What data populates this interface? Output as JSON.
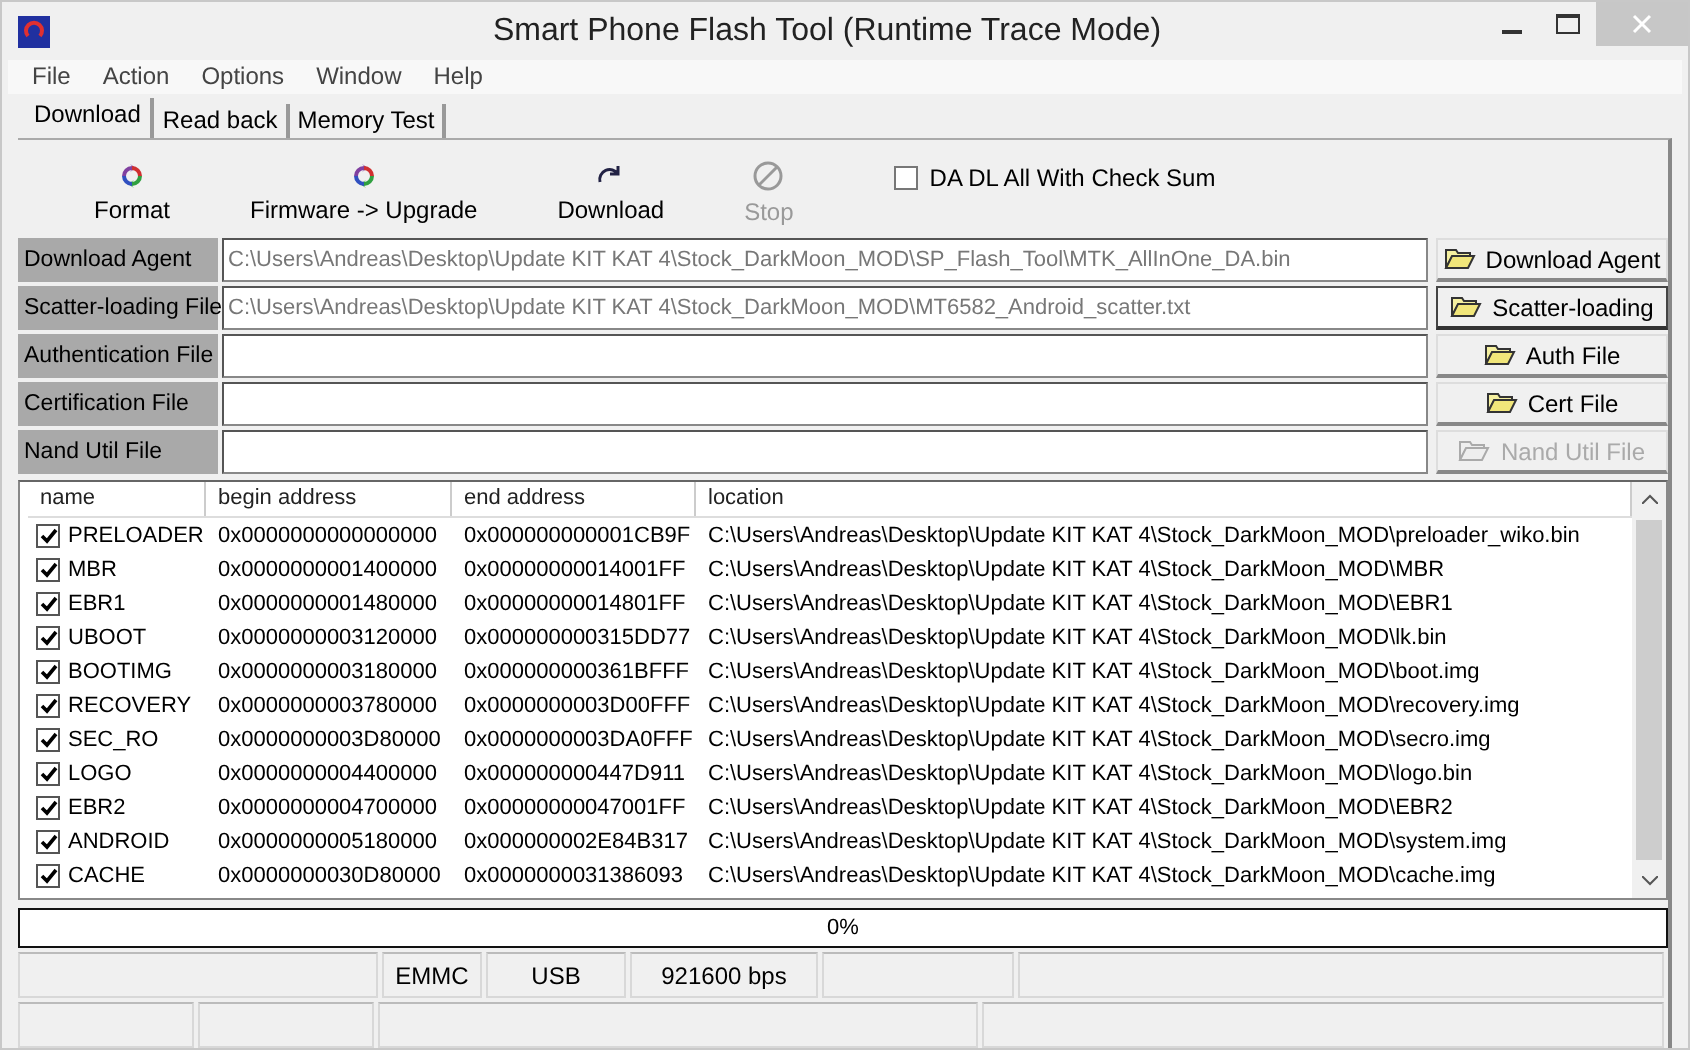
{
  "window": {
    "title": "Smart Phone Flash Tool (Runtime Trace Mode)"
  },
  "menu": [
    "File",
    "Action",
    "Options",
    "Window",
    "Help"
  ],
  "tabs": [
    {
      "label": "Download",
      "selected": true
    },
    {
      "label": "Read back",
      "selected": false
    },
    {
      "label": "Memory Test",
      "selected": false
    }
  ],
  "toolbar": {
    "buttons": [
      {
        "kind": "format",
        "label": "Format",
        "disabled": false
      },
      {
        "kind": "upgrade",
        "label": "Firmware -> Upgrade",
        "disabled": false
      },
      {
        "kind": "download",
        "label": "Download",
        "disabled": false
      },
      {
        "kind": "stop",
        "label": "Stop",
        "disabled": true
      }
    ],
    "checkbox": {
      "label": "DA DL All With Check Sum",
      "checked": false
    }
  },
  "files": [
    {
      "label": "Download Agent",
      "value": "C:\\Users\\Andreas\\Desktop\\Update KIT KAT 4\\Stock_DarkMoon_MOD\\SP_Flash_Tool\\MTK_AllInOne_DA.bin",
      "button": "Download Agent",
      "focused": false,
      "disabled": false
    },
    {
      "label": "Scatter-loading File",
      "value": "C:\\Users\\Andreas\\Desktop\\Update KIT KAT 4\\Stock_DarkMoon_MOD\\MT6582_Android_scatter.txt",
      "button": "Scatter-loading",
      "focused": true,
      "disabled": false
    },
    {
      "label": "Authentication File",
      "button": "Auth File",
      "focused": false,
      "disabled": false
    },
    {
      "label": "Certification File",
      "button": "Cert File",
      "focused": false,
      "disabled": false
    },
    {
      "label": "Nand Util File",
      "button": "Nand Util File",
      "focused": false,
      "disabled": true
    }
  ],
  "table": {
    "columns": [
      "name",
      "begin address",
      "end address",
      "location"
    ],
    "rows": [
      {
        "checked": true,
        "name": "PRELOADER",
        "begin": "0x0000000000000000",
        "end": "0x000000000001CB9F",
        "location": "C:\\Users\\Andreas\\Desktop\\Update KIT KAT 4\\Stock_DarkMoon_MOD\\preloader_wiko.bin"
      },
      {
        "checked": true,
        "name": "MBR",
        "begin": "0x0000000001400000",
        "end": "0x00000000014001FF",
        "location": "C:\\Users\\Andreas\\Desktop\\Update KIT KAT 4\\Stock_DarkMoon_MOD\\MBR"
      },
      {
        "checked": true,
        "name": "EBR1",
        "begin": "0x0000000001480000",
        "end": "0x00000000014801FF",
        "location": "C:\\Users\\Andreas\\Desktop\\Update KIT KAT 4\\Stock_DarkMoon_MOD\\EBR1"
      },
      {
        "checked": true,
        "name": "UBOOT",
        "begin": "0x0000000003120000",
        "end": "0x000000000315DD77",
        "location": "C:\\Users\\Andreas\\Desktop\\Update KIT KAT 4\\Stock_DarkMoon_MOD\\lk.bin"
      },
      {
        "checked": true,
        "name": "BOOTIMG",
        "begin": "0x0000000003180000",
        "end": "0x000000000361BFFF",
        "location": "C:\\Users\\Andreas\\Desktop\\Update KIT KAT 4\\Stock_DarkMoon_MOD\\boot.img"
      },
      {
        "checked": true,
        "name": "RECOVERY",
        "begin": "0x0000000003780000",
        "end": "0x0000000003D00FFF",
        "location": "C:\\Users\\Andreas\\Desktop\\Update KIT KAT 4\\Stock_DarkMoon_MOD\\recovery.img"
      },
      {
        "checked": true,
        "name": "SEC_RO",
        "begin": "0x0000000003D80000",
        "end": "0x0000000003DA0FFF",
        "location": "C:\\Users\\Andreas\\Desktop\\Update KIT KAT 4\\Stock_DarkMoon_MOD\\secro.img"
      },
      {
        "checked": true,
        "name": "LOGO",
        "begin": "0x0000000004400000",
        "end": "0x000000000447D911",
        "location": "C:\\Users\\Andreas\\Desktop\\Update KIT KAT 4\\Stock_DarkMoon_MOD\\logo.bin"
      },
      {
        "checked": true,
        "name": "EBR2",
        "begin": "0x0000000004700000",
        "end": "0x00000000047001FF",
        "location": "C:\\Users\\Andreas\\Desktop\\Update KIT KAT 4\\Stock_DarkMoon_MOD\\EBR2"
      },
      {
        "checked": true,
        "name": "ANDROID",
        "begin": "0x0000000005180000",
        "end": "0x000000002E84B317",
        "location": "C:\\Users\\Andreas\\Desktop\\Update KIT KAT 4\\Stock_DarkMoon_MOD\\system.img"
      },
      {
        "checked": true,
        "name": "CACHE",
        "begin": "0x0000000030D80000",
        "end": "0x0000000031386093",
        "location": "C:\\Users\\Andreas\\Desktop\\Update KIT KAT 4\\Stock_DarkMoon_MOD\\cache.img"
      }
    ]
  },
  "progress": {
    "text": "0%",
    "level": 0
  },
  "status_bar": [
    "EMMC",
    "USB",
    "921600 bps"
  ]
}
